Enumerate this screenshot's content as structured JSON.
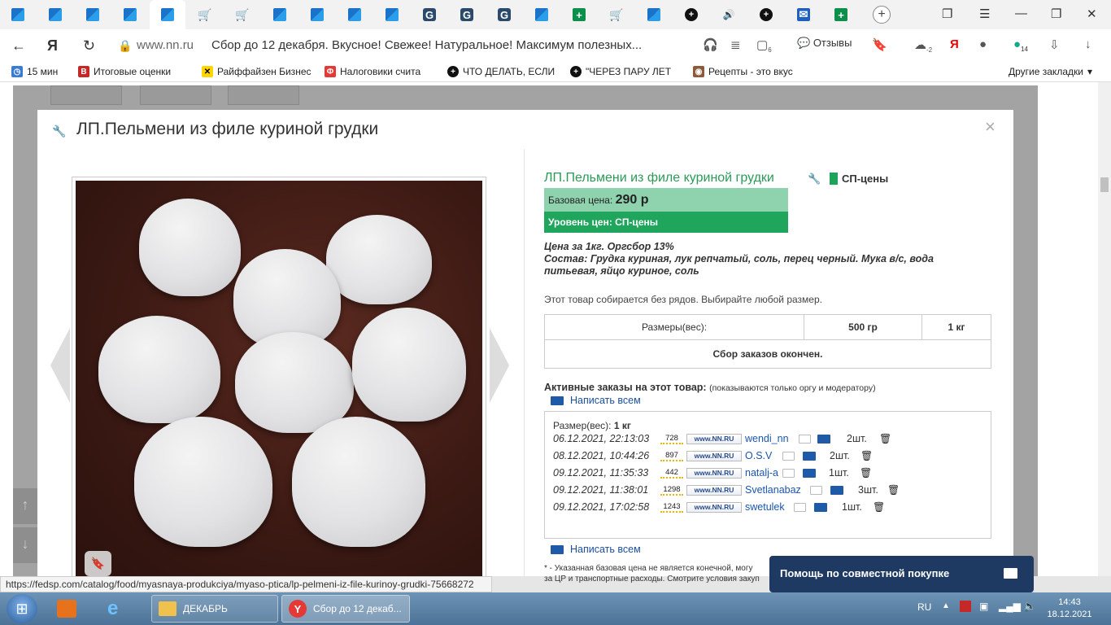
{
  "browser": {
    "tabs": [
      "blue-win",
      "blue-win",
      "blue-win",
      "blue-win",
      "blue-win",
      "cart",
      "cart",
      "blue-win",
      "blue-win",
      "blue-win",
      "G",
      "G",
      "G",
      "blue-win",
      "green-plus",
      "cart",
      "blue-win",
      "dark-plus",
      "speaker",
      "dark-plus",
      "mail",
      "green-plus"
    ],
    "new_tab": "+",
    "url_host": "www.nn.ru",
    "page_title": "Сбор до 12 декабря. Вкусное! Свежее! Натуральное! Максимум полезных...",
    "reviews_label": "Отзывы",
    "badge_tab_count": "6",
    "badge_cloud": "-2",
    "badge_mail": "14",
    "bookmarks": [
      "15 мин",
      "Итоговые оценки",
      "Райффайзен Бизнес",
      "Налоговики счита",
      "ЧТО ДЕЛАТЬ, ЕСЛИ",
      "\"ЧЕРЕЗ ПАРУ ЛЕТ",
      "Рецепты - это вкус"
    ],
    "other_bookmarks": "Другие закладки"
  },
  "modal": {
    "title": "ЛП.Пельмени из филе куриной грудки",
    "close": "×"
  },
  "product": {
    "title": "ЛП.Пельмени из филе куриной грудки",
    "sp_tag": "СП-цены",
    "base_price_label": "Базовая цена:",
    "base_price": "290 р",
    "price_level": "Уровень цен: СП-цены",
    "desc_line1": "Цена за 1кг. Оргсбор 13%",
    "desc_line2": "Состав: Грудка куриная, лук репчатый, соль, перец черный. Мука в/с, вода питьевая, яйцо куриное, соль",
    "no_rows_note": "Этот товар собирается без рядов. Выбирайте любой размер.",
    "sizes_label": "Размеры(вес):",
    "sizes": [
      "500 гр",
      "1 кг"
    ],
    "collection_status": "Сбор заказов окончен.",
    "orders_heading": "Активные заказы на этот товар:",
    "orders_note": "(показываются только оргу и модератору)",
    "write_all": "Написать всем",
    "orders_size_label": "Размер(вес):",
    "orders_size_value": "1 кг",
    "orders": [
      {
        "date": "06.12.2021, 22:13:03",
        "rep": "728",
        "user": "wendi_nn",
        "qty": "2шт."
      },
      {
        "date": "08.12.2021, 10:44:26",
        "rep": "897",
        "user": "O.S.V",
        "qty": "2шт."
      },
      {
        "date": "09.12.2021, 11:35:33",
        "rep": "442",
        "user": "natalj-a",
        "qty": "1шт."
      },
      {
        "date": "09.12.2021, 11:38:01",
        "rep": "1298",
        "user": "Svetlanabaz",
        "qty": "3шт."
      },
      {
        "date": "09.12.2021, 17:02:58",
        "rep": "1243",
        "user": "swetulek",
        "qty": "1шт."
      }
    ],
    "nn_logo": "www.NN.RU",
    "footnote_line1": "* - Указанная базовая цена не является конечной, могу",
    "footnote_line2": "за ЦР и транспортные расходы. Смотрите условия закуп"
  },
  "help_popup": "Помощь по совместной покупке",
  "status_url": "https://fedsp.com/catalog/food/myasnaya-produkciya/myaso-ptica/lp-pelmeni-iz-file-kurinoy-grudki-75668272",
  "taskbar": {
    "folder_label": "ДЕКАБРЬ",
    "browser_label": "Сбор до 12 декаб...",
    "lang": "RU",
    "time": "14:43",
    "date": "18.12.2021"
  },
  "colors": {
    "accent_green": "#20a65c",
    "price_bg": "#8fd3ae",
    "link_blue": "#1a55b0",
    "help_bg": "#1e3a63"
  }
}
